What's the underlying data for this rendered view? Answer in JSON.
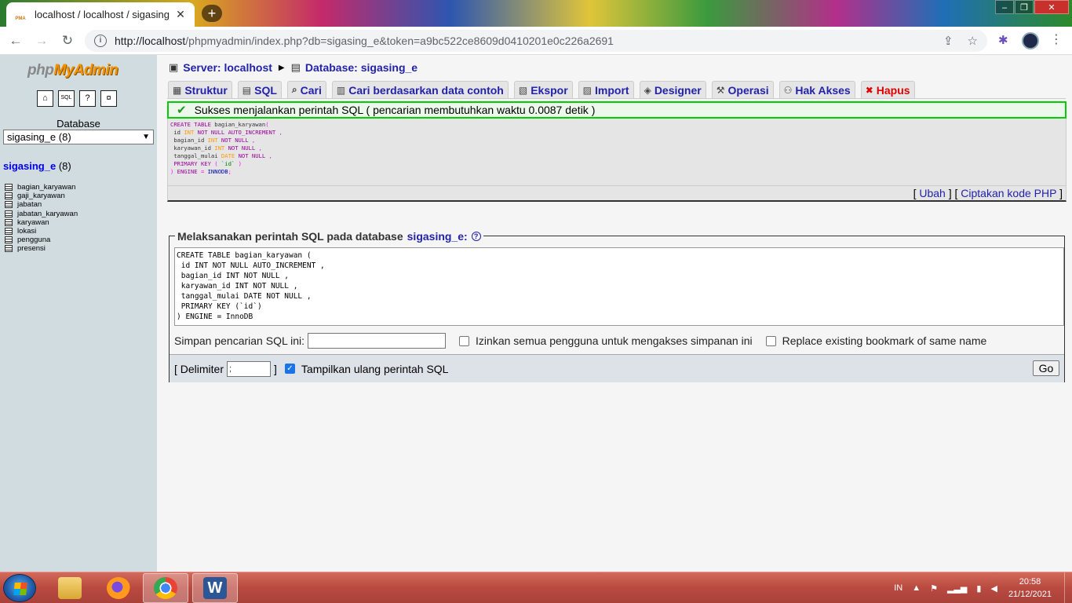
{
  "browser": {
    "tab_title": "localhost / localhost / sigasing_e",
    "tab_favicon": "PMA",
    "url_host": "http://localhost",
    "url_path": "/phpmyadmin/index.php?db=sigasing_e&token=a9bc522ce8609d0410201e0c226a2691"
  },
  "left": {
    "logo_php": "php",
    "logo_myadmin": "MyAdmin",
    "db_label": "Database",
    "db_select": "sigasing_e (8)",
    "db_name": "sigasing_e",
    "db_count": "(8)",
    "tables": [
      "bagian_karyawan",
      "gaji_karyawan",
      "jabatan",
      "jabatan_karyawan",
      "karyawan",
      "lokasi",
      "pengguna",
      "presensi"
    ]
  },
  "main": {
    "server_label": "Server: localhost",
    "database_label": "Database: sigasing_e",
    "tabs": [
      "Struktur",
      "SQL",
      "Cari",
      "Cari berdasarkan data contoh",
      "Ekspor",
      "Import",
      "Designer",
      "Operasi",
      "Hak Akses",
      "Hapus"
    ],
    "success_msg": "Sukses menjalankan perintah SQL ( pencarian membutuhkan waktu 0.0087 detik )",
    "ubah": "Ubah",
    "php_code": "Ciptakan kode PHP",
    "fieldset_legend": "Melaksanakan perintah SQL pada database",
    "fieldset_db": "sigasing_e:",
    "sql_text": "CREATE TABLE bagian_karyawan (\n id INT NOT NULL AUTO_INCREMENT ,\n bagian_id INT NOT NULL ,\n karyawan_id INT NOT NULL ,\n tanggal_mulai DATE NOT NULL ,\n PRIMARY KEY (`id`)\n) ENGINE = InnoDB",
    "save_label": "Simpan pencarian SQL ini:",
    "allow_label": "Izinkan semua pengguna untuk mengakses simpanan ini",
    "replace_label": "Replace existing bookmark of same name",
    "delimiter_open": "[ Delimiter",
    "delimiter_value": ";",
    "delimiter_close": "]",
    "show_again_label": "Tampilkan ulang perintah SQL",
    "go_label": "Go"
  },
  "taskbar": {
    "lang": "IN",
    "time": "20:58",
    "date": "21/12/2021"
  }
}
